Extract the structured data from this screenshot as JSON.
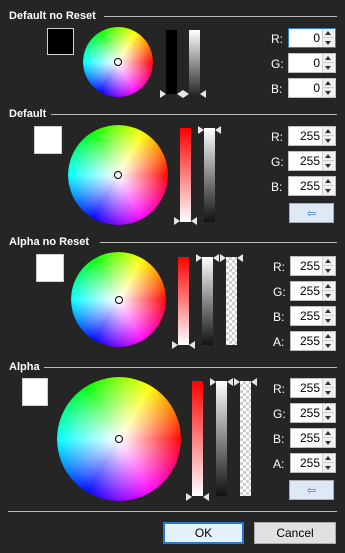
{
  "sections": [
    {
      "title": "Default no Reset",
      "r": "0",
      "g": "0",
      "b": "0",
      "swatch": "#000000"
    },
    {
      "title": "Default",
      "r": "255",
      "g": "255",
      "b": "255",
      "swatch": "#ffffff",
      "reset_icon": "⇦"
    },
    {
      "title": "Alpha no Reset",
      "r": "255",
      "g": "255",
      "b": "255",
      "a": "255",
      "swatch": "#ffffff"
    },
    {
      "title": "Alpha",
      "r": "255",
      "g": "255",
      "b": "255",
      "a": "255",
      "swatch": "#ffffff",
      "reset_icon": "⇦"
    }
  ],
  "labels": {
    "r": "R:",
    "g": "G:",
    "b": "B:",
    "a": "A:"
  },
  "footer": {
    "ok": "OK",
    "cancel": "Cancel"
  },
  "colors": {
    "background": "#252525",
    "accent": "#1e7ad3"
  },
  "icons": {
    "reset": "arrow-left-icon",
    "spin_up": "chevron-up-icon",
    "spin_down": "chevron-down-icon"
  }
}
